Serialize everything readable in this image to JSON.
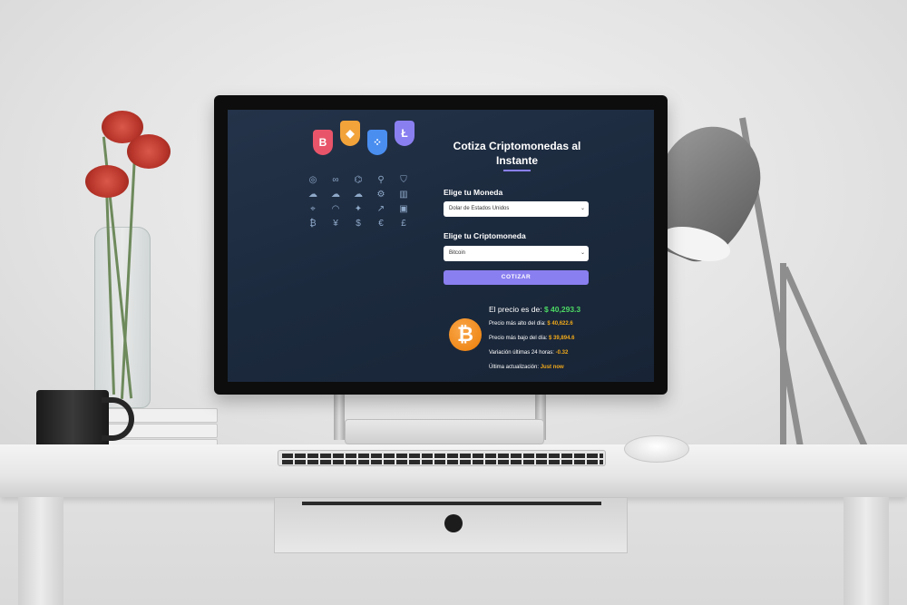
{
  "app": {
    "title": "Cotiza Criptomonedas al Instante",
    "currency_label": "Elige tu Moneda",
    "currency_selected": "Dolar de Estados Unidos",
    "crypto_label": "Elige tu Criptomoneda",
    "crypto_selected": "Bitcoin",
    "quote_button": "COTIZAR"
  },
  "result": {
    "coin_symbol": "₿",
    "price_label": "El precio es de:",
    "price_value": "$ 40,293.3",
    "high_label": "Precio más alto del día:",
    "high_value": "$ 40,622.6",
    "low_label": "Precio más bajo del día:",
    "low_value": "$ 39,894.6",
    "change_label": "Variación últimas 24 horas:",
    "change_value": "-0.32",
    "updated_label": "Última actualización:",
    "updated_value": "Just now"
  },
  "decor": {
    "badges": [
      {
        "glyph": "B",
        "color": "#e8556a"
      },
      {
        "glyph": "◆",
        "color": "#f2a33a"
      },
      {
        "glyph": "⁘",
        "color": "#4a8ef0"
      },
      {
        "glyph": "Ł",
        "color": "#8a7ff0"
      }
    ],
    "icons": [
      "globe-icon",
      "link-icon",
      "network-icon",
      "bag-icon",
      "shield-icon",
      "cloud-icon",
      "cloud-upload-icon",
      "cloud-sync-icon",
      "gear-icon",
      "chart-bars-icon",
      "pin-icon",
      "wifi-icon",
      "bulb-icon",
      "trend-icon",
      "lock-icon",
      "bitcoin-icon",
      "yen-icon",
      "dollar-icon",
      "euro-icon",
      "pound-icon"
    ],
    "icon_glyphs": [
      "◎",
      "∞",
      "⌬",
      "⚲",
      "⛉",
      "☁",
      "☁",
      "☁",
      "⚙",
      "▥",
      "⌖",
      "◠",
      "✦",
      "↗",
      "▣",
      "₿",
      "¥",
      "$",
      "€",
      "£"
    ]
  }
}
